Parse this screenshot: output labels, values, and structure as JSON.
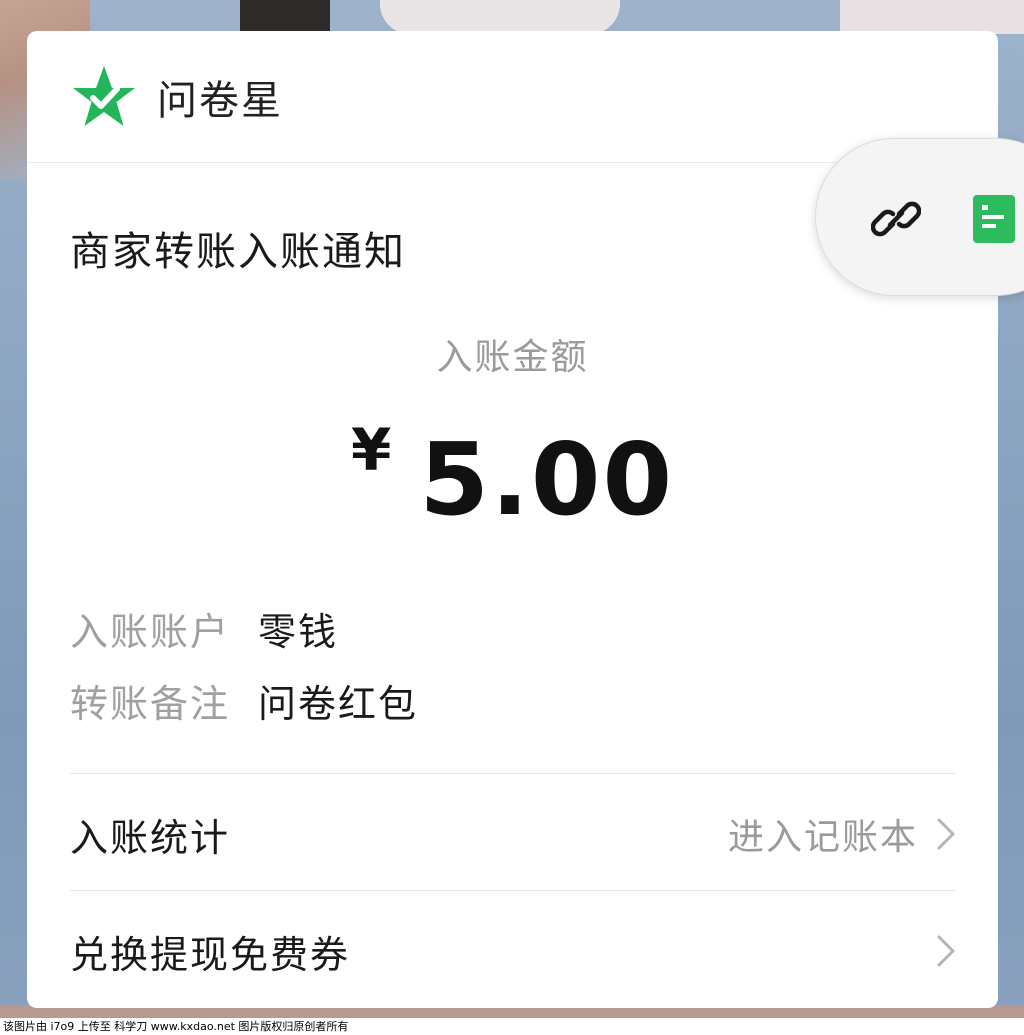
{
  "header": {
    "app_name": "问卷星"
  },
  "notice": {
    "title": "商家转账入账通知"
  },
  "amount": {
    "label": "入账金额",
    "currency": "¥",
    "value": "5.00"
  },
  "details": [
    {
      "key": "入账账户",
      "value": "零钱"
    },
    {
      "key": "转账备注",
      "value": "问卷红包"
    }
  ],
  "actions": {
    "stats": {
      "label": "入账统计",
      "hint": "进入记账本"
    },
    "coupon": {
      "label": "兑换提现免费券"
    }
  },
  "floating_toolbar": {
    "icons": [
      "link-icon",
      "document-icon"
    ]
  },
  "watermark": {
    "text": "该图片由 i7o9 上传至 科学刀 www.kxdao.net 图片版权归原创者所有"
  },
  "colors": {
    "brand_green": "#22b559",
    "doc_green": "#2dbb5e"
  }
}
